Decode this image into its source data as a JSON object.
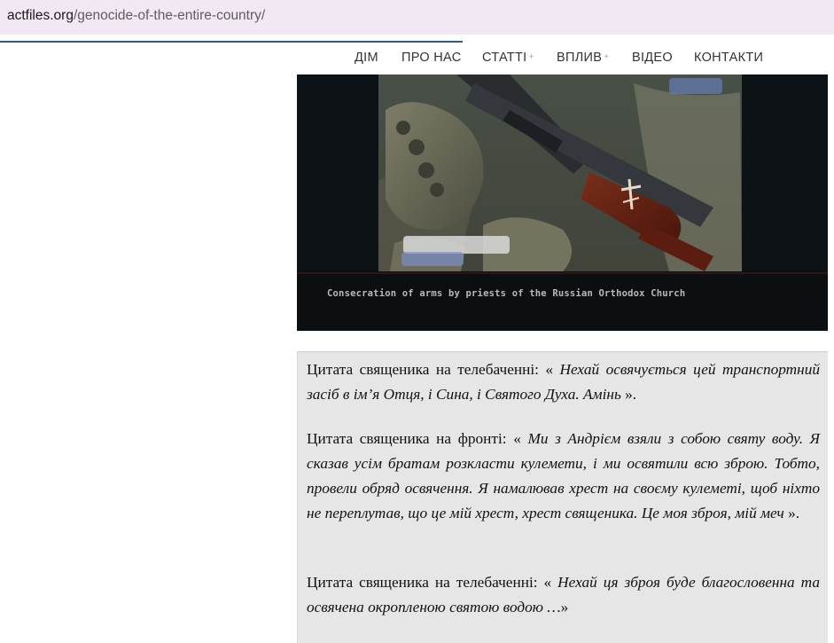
{
  "browser": {
    "url_host": "actfiles.org",
    "url_path": "/genocide-of-the-entire-country/"
  },
  "nav": {
    "items": [
      {
        "label": "ДІМ",
        "has_submenu": false
      },
      {
        "label": "ПРО НАС",
        "has_submenu": false
      },
      {
        "label": "СТАТТІ",
        "has_submenu": true
      },
      {
        "label": "ВПЛИВ",
        "has_submenu": true
      },
      {
        "label": "ВІДЕО",
        "has_submenu": false
      },
      {
        "label": "КОНТАКТИ",
        "has_submenu": false
      }
    ],
    "submenu_glyph": "+"
  },
  "image": {
    "caption": "Consecration of arms by priests of the Russian Orthodox Church"
  },
  "quotes": [
    {
      "intro": "Цитата священика на телебаченні: «",
      "quote": " Нехай освячується цей транспортний засіб в ім’я Отця, і Сина, і Святого Духа. Амінь",
      "outro": " »."
    },
    {
      "intro": "Цитата священика на фронті: «",
      "quote": " Ми з Андрієм взяли з собою святу воду. Я сказав усім братам розкласти кулемети, і ми освятили всю зброю. Тобто, провели обряд освячення. Я намалював хрест на своєму кулеметі, щоб ніхто не переплутав, що це мій хрест, хрест священика. Це моя зброя, мій меч",
      "outro": " »."
    },
    {
      "intro": "Цитата священика на телебаченні: «",
      "quote": " Нехай ця зброя буде благословенна та освячена окропленою святою водою …",
      "outro": "»"
    }
  ]
}
